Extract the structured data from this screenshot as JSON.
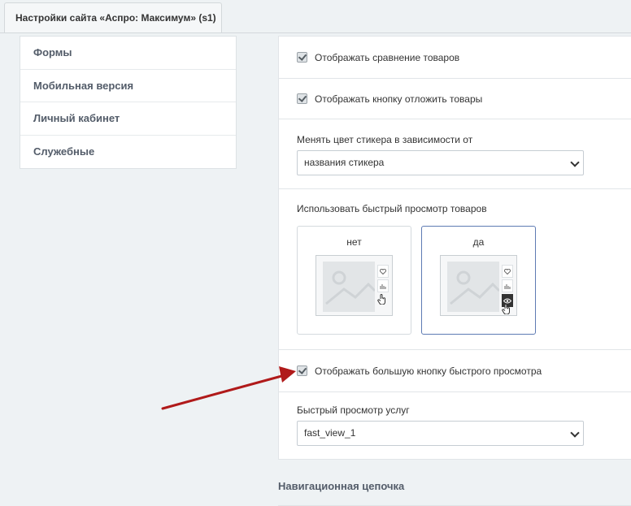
{
  "window": {
    "tab_title": "Настройки сайта «Аспро: Максимум» (s1)"
  },
  "sidebar": {
    "items": [
      {
        "label": "Формы"
      },
      {
        "label": "Мобильная версия"
      },
      {
        "label": "Личный кабинет"
      },
      {
        "label": "Служебные"
      }
    ]
  },
  "settings": {
    "compare": {
      "label": "Отображать сравнение товаров",
      "checked": true
    },
    "delay": {
      "label": "Отображать кнопку отложить товары",
      "checked": true
    },
    "sticker_color": {
      "label": "Менять цвет стикера в зависимости от",
      "value": "названия стикера"
    },
    "quick_view": {
      "label": "Использовать быстрый просмотр товаров",
      "options": [
        {
          "label": "нет",
          "selected": false
        },
        {
          "label": "да",
          "selected": true
        }
      ]
    },
    "big_quick_view": {
      "label": "Отображать большую кнопку быстрого просмотра",
      "checked": true
    },
    "services_quick_view": {
      "label": "Быстрый просмотр услуг",
      "value": "fast_view_1"
    }
  },
  "next_section": {
    "title": "Навигационная цепочка"
  },
  "colors": {
    "arrow": "#b01a1a",
    "selected_border": "#5e7bb3"
  },
  "icons": [
    "heart-icon",
    "chart-icon",
    "eye-icon",
    "hand-cursor-icon",
    "image-placeholder-icon",
    "chevron-down-icon",
    "check-icon"
  ]
}
